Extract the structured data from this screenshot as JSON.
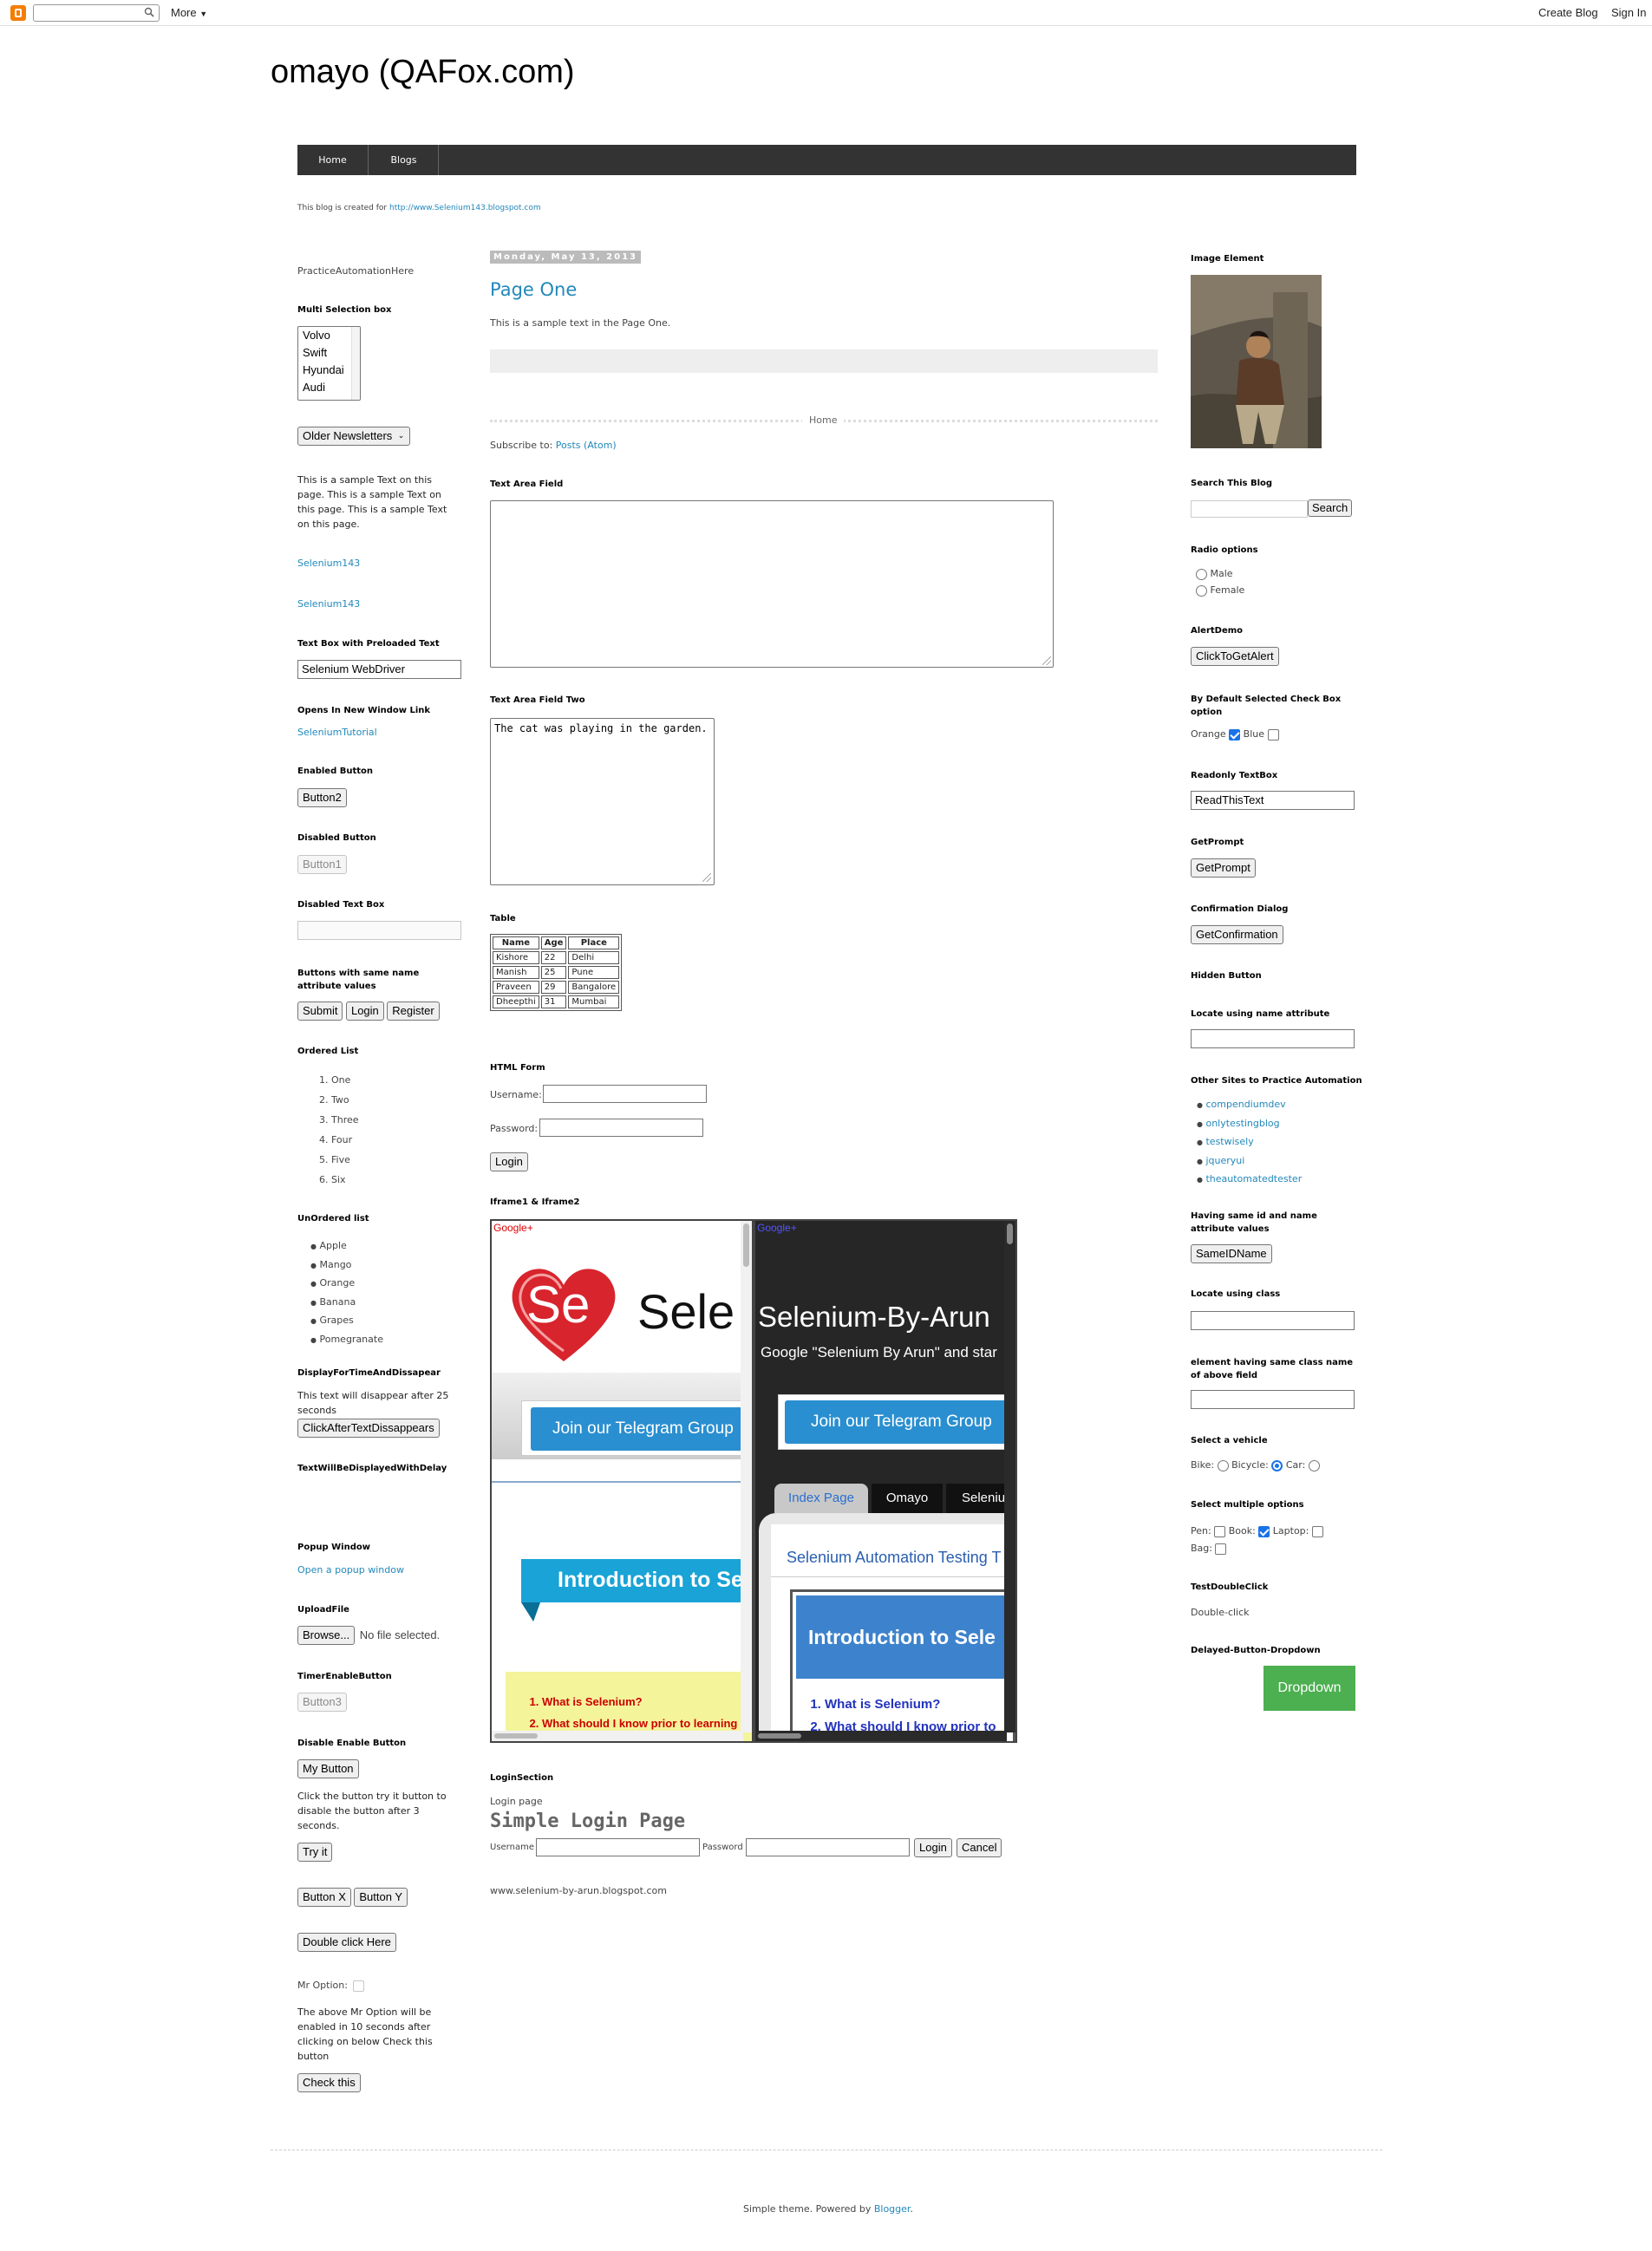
{
  "navbar": {
    "search_placeholder": "",
    "more_label": "More",
    "create_blog": "Create Blog",
    "sign_in": "Sign In"
  },
  "blog": {
    "title": "omayo (QAFox.com)",
    "created_text": "This blog is created for",
    "created_link": "http://www.Selenium143.blogspot.com"
  },
  "tabs": [
    "Home",
    "Blogs"
  ],
  "left": {
    "practice_text": "PracticeAutomationHere",
    "multi_select": {
      "title": "Multi Selection box",
      "options": [
        "Volvo",
        "Swift",
        "Hyundai",
        "Audi"
      ]
    },
    "older_newsletters": "Older Newsletters",
    "sample_text": "This is a sample Text on this page. This is a sample Text on this page. This is a sample Text on this page.",
    "selenium_link1": "Selenium143",
    "selenium_link2": "Selenium143",
    "preloaded": {
      "title": "Text Box with Preloaded Text",
      "value": "Selenium WebDriver"
    },
    "new_window": {
      "title": "Opens In New Window Link",
      "link": "SeleniumTutorial"
    },
    "enabled": {
      "title": "Enabled Button",
      "button": "Button2"
    },
    "disabled": {
      "title": "Disabled Button",
      "button": "Button1"
    },
    "disabled_text": {
      "title": "Disabled Text Box"
    },
    "same_name": {
      "title": "Buttons with same name attribute values",
      "buttons": [
        "Submit",
        "Login",
        "Register"
      ]
    },
    "ordered": {
      "title": "Ordered List",
      "items": [
        "One",
        "Two",
        "Three",
        "Four",
        "Five",
        "Six"
      ]
    },
    "unordered": {
      "title": "UnOrdered list",
      "items": [
        "Apple",
        "Mango",
        "Orange",
        "Banana",
        "Grapes",
        "Pomegranate"
      ]
    },
    "disappear": {
      "title": "DisplayForTimeAndDissapear",
      "text": "This text will disappear after 25 seconds",
      "button": "ClickAfterTextDissappears"
    },
    "delay": {
      "title": "TextWillBeDisplayedWithDelay"
    },
    "popup": {
      "title": "Popup Window",
      "link": "Open a popup window"
    },
    "upload": {
      "title": "UploadFile",
      "button": "Browse...",
      "status": "No file selected."
    },
    "timer": {
      "title": "TimerEnableButton",
      "button": "Button3"
    },
    "disable_enable": {
      "title": "Disable Enable Button",
      "button": "My Button",
      "text": "Click the button try it button to disable the button after 3 seconds.",
      "try": "Try it"
    },
    "xy": [
      "Button X",
      "Button Y"
    ],
    "dbl_here": "Double click Here",
    "mr_option": {
      "label": "Mr Option:",
      "text": "The above Mr Option will be enabled in 10 seconds after clicking on below Check this button",
      "button": "Check this"
    }
  },
  "main": {
    "date": "Monday, May 13, 2013",
    "post_title": "Page One",
    "post_text": "This is a sample text in the Page One.",
    "home_link": "Home",
    "subscribe": "Subscribe to:",
    "subscribe_link": "Posts (Atom)",
    "textarea1": {
      "title": "Text Area Field",
      "value": ""
    },
    "textarea2": {
      "title": "Text Area Field Two",
      "value": "The cat was playing in the garden."
    },
    "table": {
      "title": "Table",
      "headers": [
        "Name",
        "Age",
        "Place"
      ],
      "rows": [
        [
          "Kishore",
          "22",
          "Delhi"
        ],
        [
          "Manish",
          "25",
          "Pune"
        ],
        [
          "Praveen",
          "29",
          "Bangalore"
        ],
        [
          "Dheepthi",
          "31",
          "Mumbai"
        ]
      ]
    },
    "form": {
      "title": "HTML Form",
      "username": "Username:",
      "password": "Password:",
      "login": "Login"
    },
    "iframes": {
      "title": "Iframe1 & Iframe2"
    },
    "iframe1": {
      "gplus": "Google+",
      "se_logo": "Se",
      "heading": "Sele",
      "telegram": "Join our Telegram Group",
      "intro": "Introduction to Se",
      "list": [
        "What is Selenium?",
        "What should I know prior to learning"
      ]
    },
    "iframe2": {
      "gplus": "Google+",
      "heading": "Selenium-By-Arun",
      "sub": "Google \"Selenium By Arun\" and star",
      "telegram": "Join our Telegram Group",
      "tabs": [
        "Index Page",
        "Omayo",
        "Seleniu"
      ],
      "panel_title": "Selenium Automation Testing T",
      "intro": "Introduction to Sele",
      "list": [
        "What is Selenium?",
        "What should I know prior to"
      ]
    },
    "login": {
      "title": "LoginSection",
      "sub": "Login page",
      "heading": "Simple Login Page",
      "username": "Username",
      "password": "Password",
      "login": "Login",
      "cancel": "Cancel"
    },
    "footer_site": "www.selenium-by-arun.blogspot.com"
  },
  "right": {
    "image_title": "Image Element",
    "search": {
      "title": "Search This Blog",
      "button": "Search"
    },
    "radio": {
      "title": "Radio options",
      "options": [
        "Male",
        "Female"
      ]
    },
    "alert": {
      "title": "AlertDemo",
      "button": "ClickToGetAlert"
    },
    "default_cb": {
      "title": "By Default Selected Check Box option",
      "orange": "Orange",
      "blue": "Blue"
    },
    "readonly": {
      "title": "Readonly TextBox",
      "value": "ReadThisText"
    },
    "prompt": {
      "title": "GetPrompt",
      "button": "GetPrompt"
    },
    "confirm": {
      "title": "Confirmation Dialog",
      "button": "GetConfirmation"
    },
    "hidden": {
      "title": "Hidden Button"
    },
    "locate_name": {
      "title": "Locate using name attribute"
    },
    "other_sites": {
      "title": "Other Sites to Practice Automation",
      "links": [
        "compendiumdev",
        "onlytestingblog",
        "testwisely",
        "jqueryui",
        "theautomatedtester"
      ]
    },
    "same_id": {
      "title": "Having same id and name attribute values",
      "button": "SameIDName"
    },
    "locate_class": {
      "title": "Locate using class"
    },
    "same_class": {
      "title": "element having same class name of above field"
    },
    "vehicle": {
      "title": "Select a vehicle",
      "bike": "Bike:",
      "bicycle": "Bicycle:",
      "car": "Car:"
    },
    "multi": {
      "title": "Select multiple options",
      "pen": "Pen:",
      "book": "Book:",
      "laptop": "Laptop:",
      "bag": "Bag:"
    },
    "dblclick": {
      "title": "TestDoubleClick",
      "text": "Double-click"
    },
    "dropdown": {
      "title": "Delayed-Button-Dropdown",
      "button": "Dropdown"
    }
  },
  "footer": {
    "text": "Simple theme. Powered by",
    "link": "Blogger",
    "dot": "."
  },
  "colors": {
    "link": "#2288bb",
    "tabbar": "#333333",
    "dropdown_green": "#4caf50",
    "telegram_blue": "#2a8fd0"
  }
}
